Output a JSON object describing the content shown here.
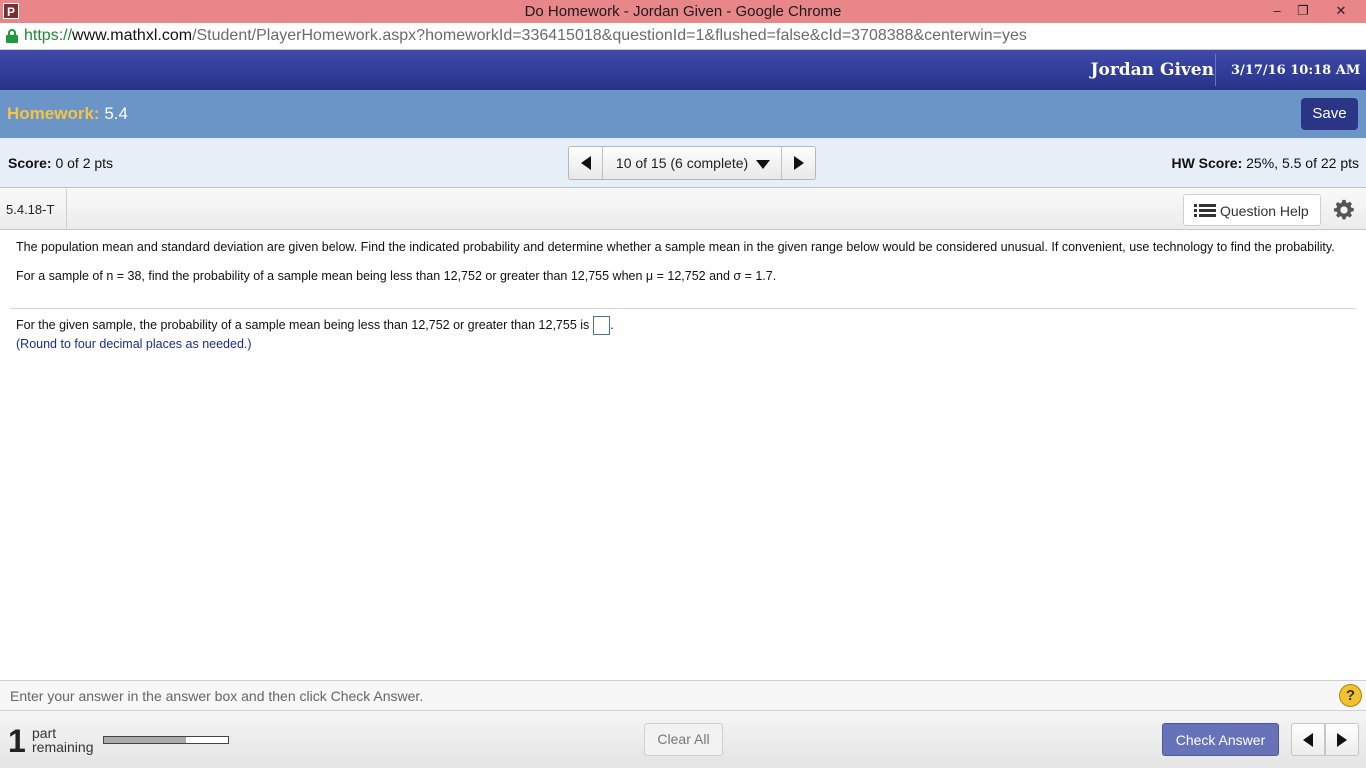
{
  "window": {
    "title": "Do Homework - Jordan Given - Google Chrome",
    "app_icon": "P",
    "minimize": "–",
    "restore": "❐",
    "close": "✕"
  },
  "address": {
    "scheme": "https://",
    "host": "www.mathxl.com",
    "path": "/Student/PlayerHomework.aspx?homeworkId=336415018&questionId=1&flushed=false&cId=3708388&centerwin=yes"
  },
  "header": {
    "user_name": "Jordan Given",
    "datetime": "3/17/16 10:18 AM"
  },
  "homework": {
    "label": "Homework:",
    "name": "5.4",
    "save_label": "Save"
  },
  "score": {
    "label": "Score:",
    "value": "0 of 2 pts",
    "hw_label": "HW Score:",
    "hw_value": "25%, 5.5 of 22 pts"
  },
  "question_nav": {
    "selected": "10 of 15 (6 complete)"
  },
  "question": {
    "id": "5.4.18-T",
    "help_label": "Question Help",
    "prompt": "The population mean and standard deviation are given below. Find the indicated probability and determine whether a sample mean in the given range below would be considered unusual. If convenient, use technology to find the probability.",
    "problem": "For a sample of n = 38, find the probability of a sample mean being less than 12,752 or greater than 12,755 when μ = 12,752 and σ = 1.7.",
    "answer_text": "For the given sample, the probability of a sample mean being less than 12,752 or greater than 12,755 is",
    "answer_suffix": ".",
    "round_note": "(Round to four decimal places as needed.)"
  },
  "footer": {
    "instruction": "Enter your answer in the answer box and then click Check Answer.",
    "help_symbol": "?",
    "parts_remaining": "1",
    "parts_label_1": "part",
    "parts_label_2": "remaining",
    "progress_fraction": 0.66,
    "clear_label": "Clear All",
    "check_label": "Check Answer"
  },
  "colors": {
    "header_blue": "#28338a",
    "homework_bar": "#6a95c6",
    "homework_label": "#f6c343",
    "save_button": "#2a3585",
    "check_button": "#6872b8",
    "help_circle": "#f2c12e"
  }
}
